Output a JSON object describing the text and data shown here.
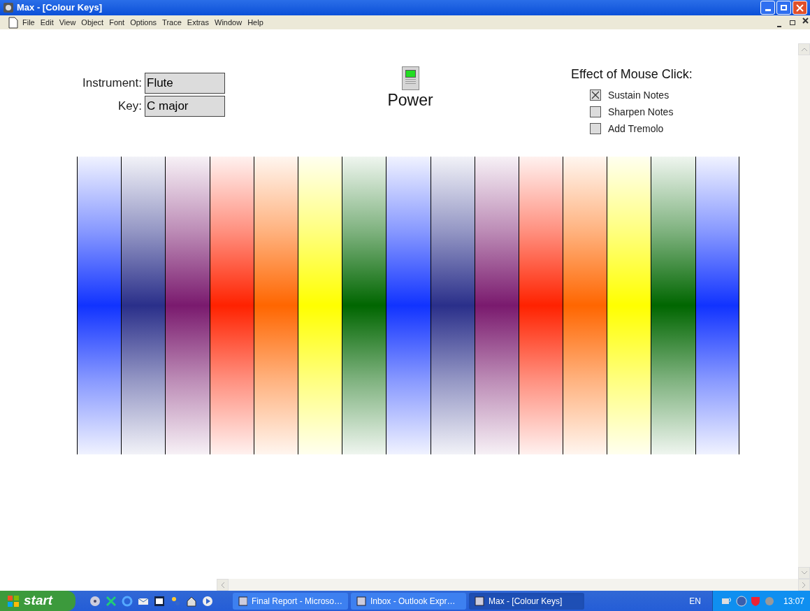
{
  "window": {
    "title": "Max - [Colour Keys]"
  },
  "menu": [
    "File",
    "Edit",
    "View",
    "Object",
    "Font",
    "Options",
    "Trace",
    "Extras",
    "Window",
    "Help"
  ],
  "fields": [
    {
      "label": "Instrument:",
      "value": "Flute"
    },
    {
      "label": "Key:",
      "value": "C major"
    }
  ],
  "power": {
    "label": "Power",
    "on": true
  },
  "mouse_click": {
    "title": "Effect of Mouse Click:",
    "options": [
      {
        "label": "Sustain Notes",
        "checked": true
      },
      {
        "label": "Sharpen Notes",
        "checked": false
      },
      {
        "label": "Add Tremolo",
        "checked": false
      }
    ]
  },
  "keys": [
    {
      "color": "#1133ff"
    },
    {
      "color": "#2a2f8a"
    },
    {
      "color": "#7a1a6e"
    },
    {
      "color": "#ff2200"
    },
    {
      "color": "#ff6600"
    },
    {
      "color": "#ffff00"
    },
    {
      "color": "#006600"
    },
    {
      "color": "#1133ff"
    },
    {
      "color": "#2a2f8a"
    },
    {
      "color": "#7a1a6e"
    },
    {
      "color": "#ff2200"
    },
    {
      "color": "#ff6600"
    },
    {
      "color": "#ffff00"
    },
    {
      "color": "#006600"
    },
    {
      "color": "#1133ff"
    }
  ],
  "taskbar": {
    "start": "start",
    "tasks": [
      {
        "label": "Final Report - Microso…",
        "selected": false
      },
      {
        "label": "Inbox - Outlook Expr…",
        "selected": false
      },
      {
        "label": "Max - [Colour Keys]",
        "selected": true
      }
    ],
    "language": "EN",
    "clock": "13:07"
  }
}
